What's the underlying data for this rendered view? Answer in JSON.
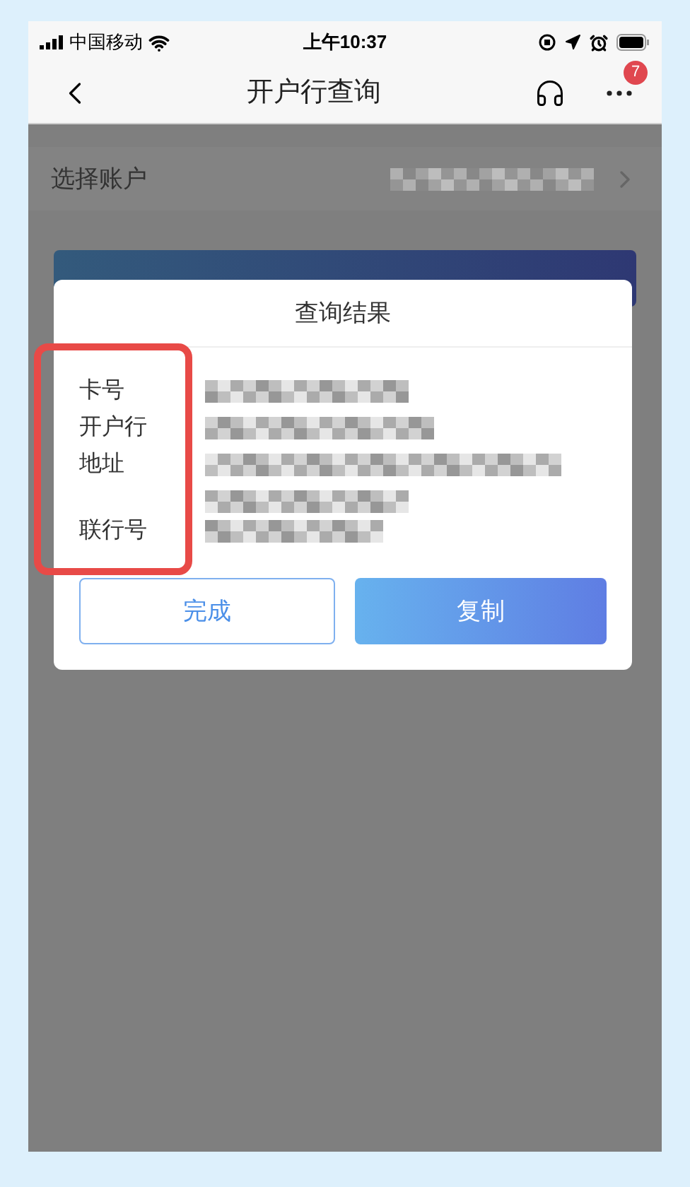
{
  "status_bar": {
    "carrier": "中国移动",
    "time": "上午10:37"
  },
  "nav": {
    "title": "开户行查询",
    "badge": "7"
  },
  "account_row": {
    "label": "选择账户"
  },
  "dialog": {
    "title": "查询结果",
    "fields": [
      {
        "label": "卡号",
        "kind": "one_line"
      },
      {
        "label": "开户行",
        "kind": "one_line"
      },
      {
        "label": "地址",
        "kind": "two_line"
      },
      {
        "label": "联行号",
        "kind": "one_line"
      }
    ],
    "buttons": [
      {
        "label": "完成",
        "kind": "outline"
      },
      {
        "label": "复制",
        "kind": "filled"
      }
    ]
  }
}
